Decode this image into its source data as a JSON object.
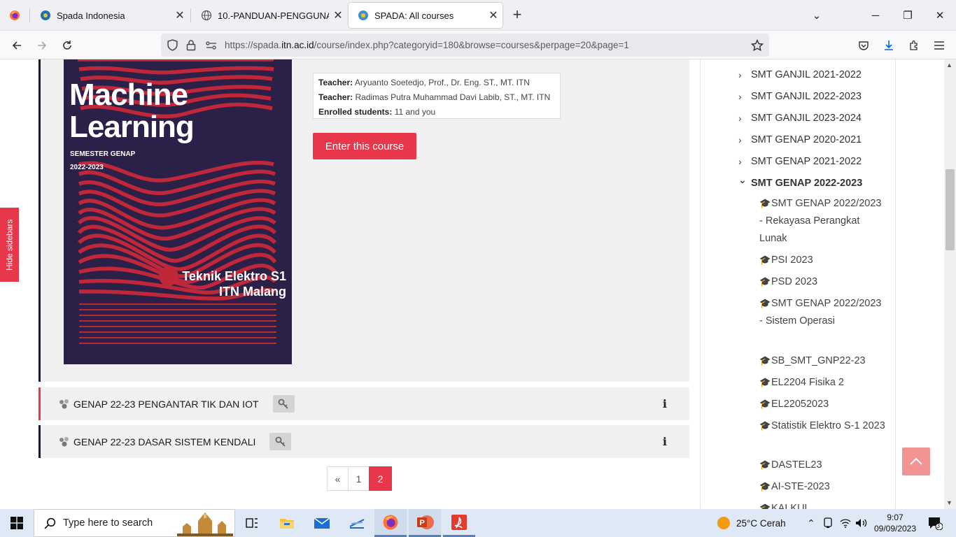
{
  "browser": {
    "tabs": [
      {
        "title": "Spada Indonesia",
        "active": false
      },
      {
        "title": "10.-PANDUAN-PENGGUNAAN-",
        "active": false
      },
      {
        "title": "SPADA: All courses",
        "active": true
      }
    ],
    "url_prefix": "https://spada.",
    "url_domain": "itn.ac.id",
    "url_path": "/course/index.php?categoryid=180&browse=courses&perpage=20&page=1"
  },
  "course_detail": {
    "cover": {
      "title_line1": "Machine",
      "title_line2": "Learning",
      "semester": "SEMESTER GENAP",
      "year": "2022-2023",
      "dept_line1": "Teknik Elektro S1",
      "dept_line2": "ITN Malang",
      "bg_color": "#2b2048",
      "stripe_color": "#c0283a"
    },
    "teacher1_label": "Teacher:",
    "teacher1": "Aryuanto Soetedjo, Prof., Dr. Eng. ST., MT. ITN",
    "teacher2_label": "Teacher:",
    "teacher2": "Radimas Putra Muhammad Davi Labib, ST., MT. ITN",
    "enrolled_label": "Enrolled students:",
    "enrolled": "11 and you",
    "enter_button": "Enter this course"
  },
  "course_list": [
    {
      "name": "GENAP 22-23 PENGANTAR TIK DAN IOT",
      "accent": "#e8364a"
    },
    {
      "name": "GENAP 22-23 DASAR SISTEM KENDALI",
      "accent": "#1a1a2e"
    }
  ],
  "pagination": {
    "prev": "«",
    "pages": [
      "1",
      "2"
    ],
    "current": "2"
  },
  "hide_sidebars": "Hide sidebars",
  "sidebar": {
    "categories": [
      {
        "label": "SMT GANJIL 2021-2022",
        "chev": "›"
      },
      {
        "label": "SMT GANJIL 2022-2023",
        "chev": "›"
      },
      {
        "label": "SMT GANJIL 2023-2024",
        "chev": "›"
      },
      {
        "label": "SMT GENAP 2020-2021",
        "chev": "›"
      },
      {
        "label": "SMT GENAP 2021-2022",
        "chev": "›"
      },
      {
        "label": "SMT GENAP 2022-2023",
        "chev": "⌄"
      }
    ],
    "courses": [
      "SMT GENAP 2022/2023 - Rekayasa Perangkat Lunak",
      "PSI 2023",
      "PSD 2023",
      "SMT GENAP 2022/2023 - Sistem Operasi",
      "SB_SMT_GNP22-23",
      "EL2204 Fisika 2",
      "EL22052023",
      "Statistik Elektro S-1 2023",
      "DASTEL23",
      "AI-STE-2023",
      "KALKUL"
    ]
  },
  "taskbar": {
    "search_placeholder": "Type here to search",
    "weather": "25°C  Cerah",
    "time": "9:07",
    "date": "09/09/2023",
    "notif_count": "3"
  }
}
